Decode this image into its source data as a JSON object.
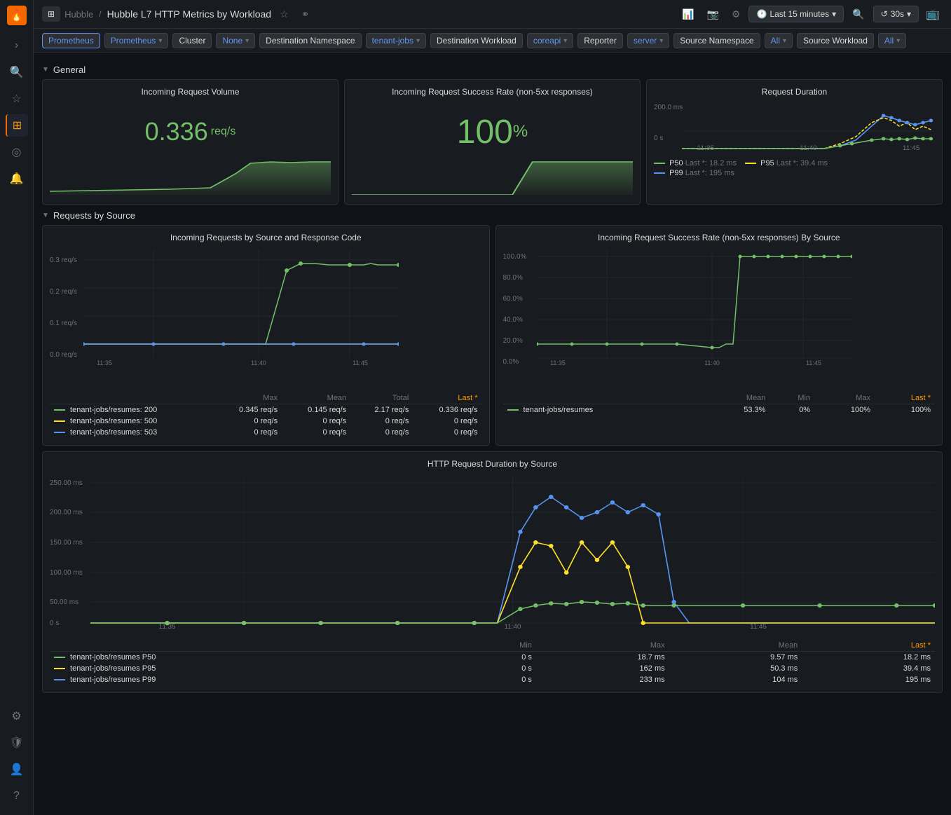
{
  "app": {
    "logo": "🔥",
    "breadcrumb_home": "Hubble",
    "breadcrumb_sep": "/",
    "page_title": "Hubble L7 HTTP Metrics by Workload"
  },
  "topbar": {
    "add_panel_icon": "📊",
    "dashboard_icon": "📷",
    "settings_icon": "⚙",
    "time_range": "Last 15 minutes",
    "zoom_icon": "🔍",
    "refresh_icon": "↺",
    "refresh_rate": "30s",
    "tv_icon": "📺"
  },
  "filters": [
    {
      "id": "datasource",
      "label": "Prometheus",
      "type": "datasource"
    },
    {
      "id": "prometheus_ds",
      "label": "Prometheus",
      "type": "dropdown"
    },
    {
      "id": "cluster",
      "label": "Cluster",
      "type": "plain"
    },
    {
      "id": "cluster_val",
      "label": "None",
      "type": "dropdown"
    },
    {
      "id": "dest_ns",
      "label": "Destination Namespace",
      "type": "plain"
    },
    {
      "id": "dest_ns_val",
      "label": "tenant-jobs",
      "type": "dropdown"
    },
    {
      "id": "dest_wl",
      "label": "Destination Workload",
      "type": "plain"
    },
    {
      "id": "dest_wl_val",
      "label": "coreapi",
      "type": "dropdown"
    },
    {
      "id": "reporter",
      "label": "Reporter",
      "type": "plain"
    },
    {
      "id": "reporter_val",
      "label": "server",
      "type": "dropdown"
    },
    {
      "id": "src_ns",
      "label": "Source Namespace",
      "type": "plain"
    },
    {
      "id": "src_ns_val",
      "label": "All",
      "type": "dropdown"
    },
    {
      "id": "src_wl",
      "label": "Source Workload",
      "type": "plain"
    },
    {
      "id": "src_wl_val",
      "label": "All",
      "type": "dropdown"
    }
  ],
  "sections": {
    "general": {
      "title": "General",
      "panels": {
        "vol": {
          "title": "Incoming Request Volume",
          "value": "0.336",
          "unit": "req/s"
        },
        "success": {
          "title": "Incoming Request Success Rate (non-5xx responses)",
          "value": "100",
          "unit": "%"
        },
        "duration": {
          "title": "Request Duration",
          "y_max": "200.0 ms",
          "y_min": "0 s",
          "x1": "11:35",
          "x2": "11:40",
          "x3": "11:45",
          "legend": [
            {
              "label": "P50",
              "color": "#73bf69",
              "style": "solid",
              "last": "Last *: 18.2 ms"
            },
            {
              "label": "P95",
              "color": "#fade2a",
              "style": "dashed",
              "last": "Last *: 39.4 ms"
            },
            {
              "label": "P99",
              "color": "#5794f2",
              "style": "solid",
              "last": "Last *: 195 ms"
            }
          ]
        }
      }
    },
    "requests_by_source": {
      "title": "Requests by Source",
      "panels": {
        "incoming_by_source": {
          "title": "Incoming Requests by Source and Response Code",
          "y_labels": [
            "0.3 req/s",
            "0.2 req/s",
            "0.1 req/s",
            "0.0 req/s"
          ],
          "x_labels": [
            "11:35",
            "11:40",
            "11:45"
          ],
          "headers": [
            "",
            "Max",
            "Mean",
            "Total",
            "Last *"
          ],
          "rows": [
            {
              "color": "#73bf69",
              "label": "tenant-jobs/resumes: 200",
              "max": "0.345 req/s",
              "mean": "0.145 req/s",
              "total": "2.17 req/s",
              "last": "0.336 req/s"
            },
            {
              "color": "#fade2a",
              "label": "tenant-jobs/resumes: 500",
              "max": "0 req/s",
              "mean": "0 req/s",
              "total": "0 req/s",
              "last": "0 req/s"
            },
            {
              "color": "#5794f2",
              "label": "tenant-jobs/resumes: 503",
              "max": "0 req/s",
              "mean": "0 req/s",
              "total": "0 req/s",
              "last": "0 req/s"
            }
          ]
        },
        "success_by_source": {
          "title": "Incoming Request Success Rate (non-5xx responses) By Source",
          "y_labels": [
            "100.0%",
            "80.0%",
            "60.0%",
            "40.0%",
            "20.0%",
            "0.0%"
          ],
          "x_labels": [
            "11:35",
            "11:40",
            "11:45"
          ],
          "headers": [
            "",
            "Mean",
            "Min",
            "Max",
            "Last *"
          ],
          "rows": [
            {
              "color": "#73bf69",
              "label": "tenant-jobs/resumes",
              "mean": "53.3%",
              "min": "0%",
              "max": "100%",
              "last": "100%"
            }
          ]
        }
      }
    },
    "http_duration": {
      "title": "HTTP Request Duration by Source",
      "y_labels": [
        "250.00 ms",
        "200.00 ms",
        "150.00 ms",
        "100.00 ms",
        "50.00 ms",
        "0 s"
      ],
      "x_labels": [
        "11:35",
        "11:40",
        "11:45"
      ],
      "headers": [
        "",
        "Min",
        "Max",
        "Mean",
        "Last *"
      ],
      "rows": [
        {
          "color": "#73bf69",
          "label": "tenant-jobs/resumes P50",
          "min": "0 s",
          "max": "18.7 ms",
          "mean": "9.57 ms",
          "last": "18.2 ms"
        },
        {
          "color": "#fade2a",
          "label": "tenant-jobs/resumes P95",
          "min": "0 s",
          "max": "162 ms",
          "mean": "50.3 ms",
          "last": "39.4 ms"
        },
        {
          "color": "#5794f2",
          "label": "tenant-jobs/resumes P99",
          "min": "0 s",
          "max": "233 ms",
          "mean": "104 ms",
          "last": "195 ms"
        }
      ]
    }
  }
}
